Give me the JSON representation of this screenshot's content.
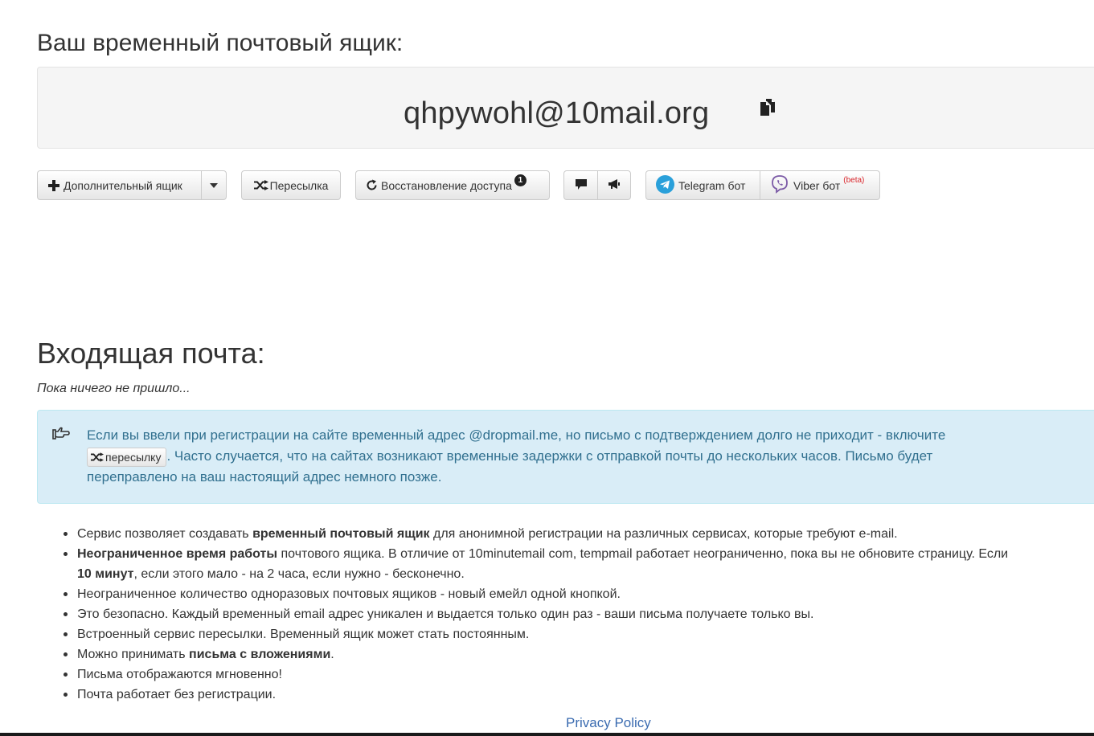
{
  "mailbox": {
    "heading": "Ваш временный почтовый ящик:",
    "address": "qhpywohl@10mail.org"
  },
  "toolbar": {
    "add_mailbox_label": "Дополнительный ящик",
    "forwarding_label": "Пересылка",
    "restore_access_label": "Восстановление доступа",
    "restore_badge": "1",
    "telegram_label": "Telegram бот",
    "viber_label": "Viber бот",
    "viber_badge": "(beta)"
  },
  "inbox": {
    "heading": "Входящая почта:",
    "empty_note": "Пока ничего не пришло..."
  },
  "info": {
    "text_before": "Если вы ввели при регистрации на сайте временный адрес @dropmail.me, но письмо с подтверждением долго не приходит - включите",
    "inline_button": "пересылку",
    "text_after": ". Часто случается, что на сайтах возникают временные задержки с отправкой почты до нескольких часов. Письмо будет переправлено на ваш настоящий адрес немного позже."
  },
  "features": [
    {
      "pre": "Сервис позволяет создавать ",
      "bold": "временный почтовый ящик",
      "post": " для анонимной регистрации на различных сервисах, которые требуют e-mail."
    },
    {
      "pre": "",
      "bold": "Неограниченное время работы",
      "post": " почтового ящика. В отличие от 10minutemail com, tempmail работает неограниченно, пока вы не обновите страницу. Если"
    },
    {
      "pre": "Неограниченное количество одноразовых почтовых ящиков - новый емейл одной кнопкой.",
      "bold": "",
      "post": ""
    },
    {
      "pre": "Это безопасно. Каждый временный email адрес уникален и выдается только один раз - ваши письма получаете только вы.",
      "bold": "",
      "post": ""
    },
    {
      "pre": "Встроенный сервис пересылки. Временный ящик может стать постоянным.",
      "bold": "",
      "post": ""
    },
    {
      "pre": "Можно принимать ",
      "bold": "письма с вложениями",
      "post": "."
    },
    {
      "pre": "Письма отображаются мгновенно!",
      "bold": "",
      "post": ""
    },
    {
      "pre": "Почта работает без регистрации.",
      "bold": "",
      "post": ""
    }
  ],
  "features_line2": {
    "bold": "10 минут",
    "post": ", если этого мало - на 2 часа, если нужно - бесконечно."
  },
  "footer": {
    "privacy_label": "Privacy Policy"
  },
  "colors": {
    "info_bg": "#d9edf7",
    "info_text": "#31708f",
    "link": "#3a6bb0",
    "beta": "#d9262c"
  }
}
